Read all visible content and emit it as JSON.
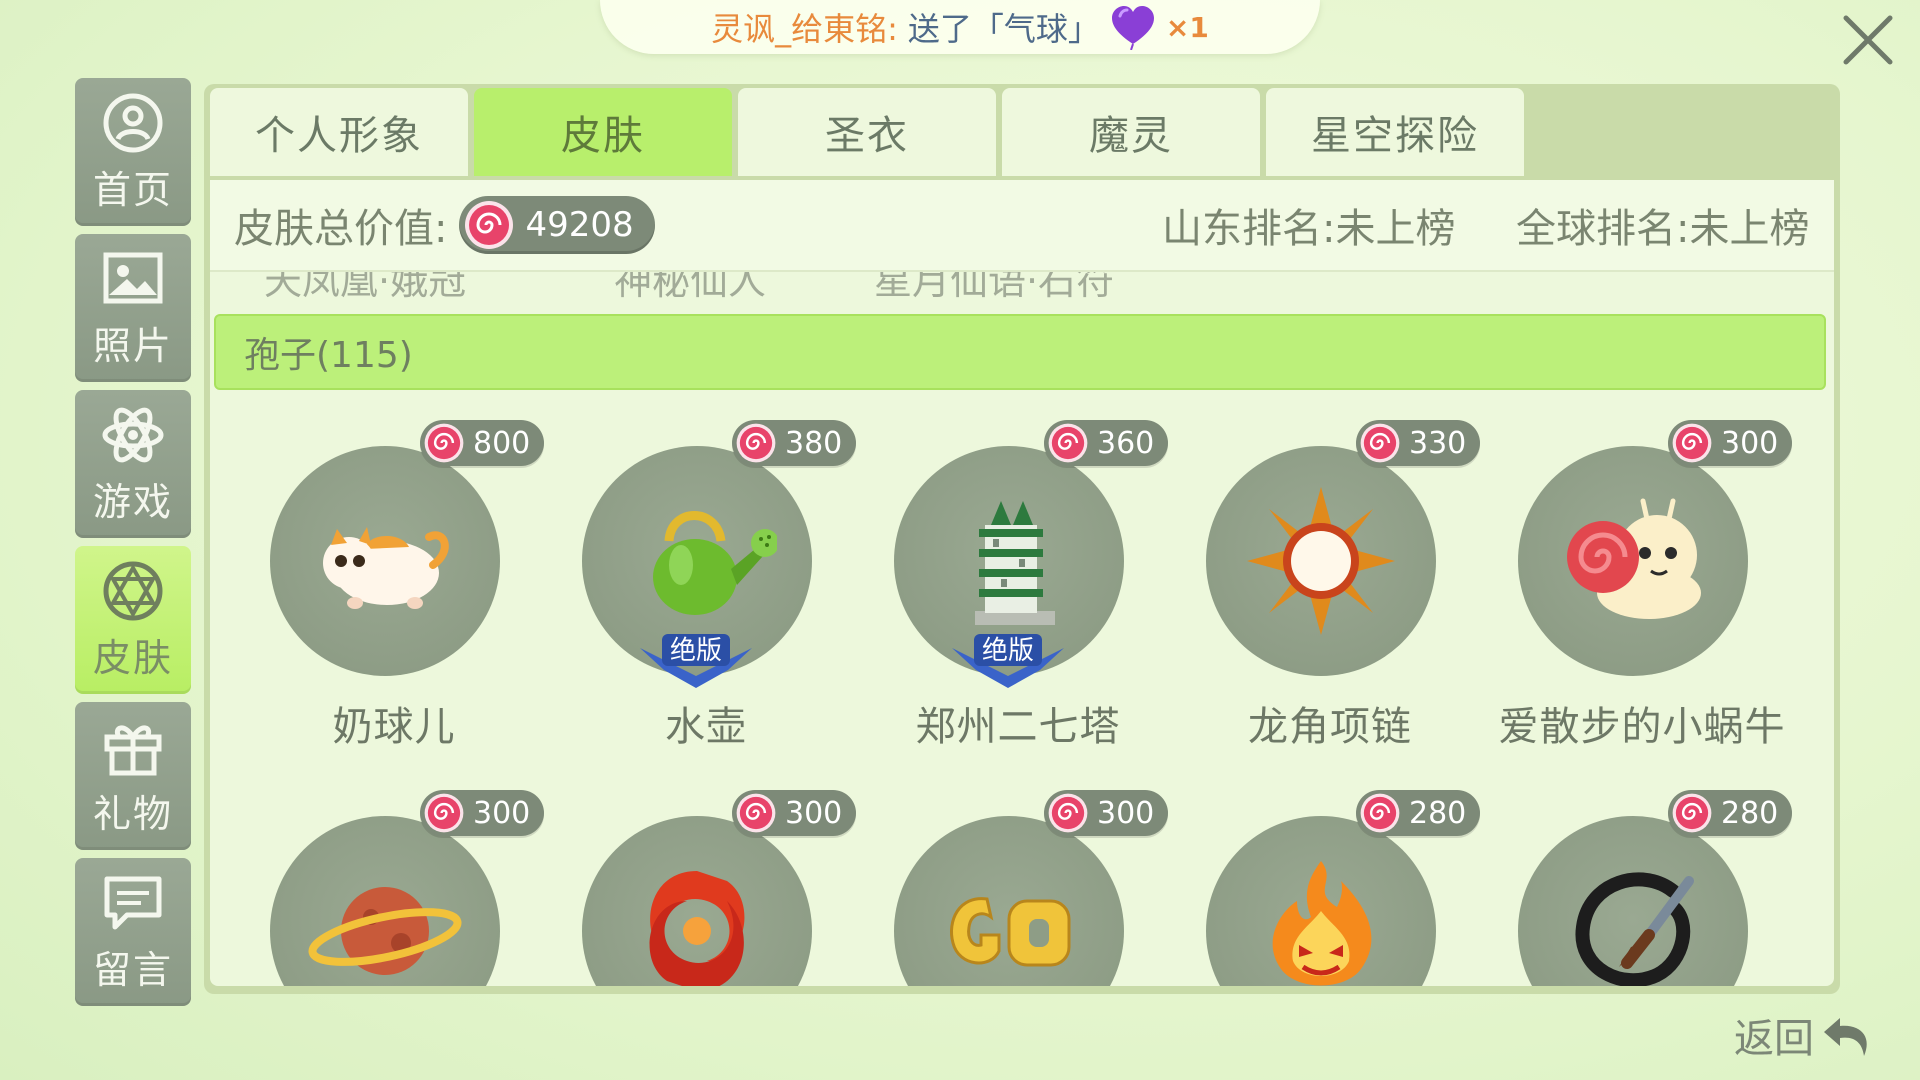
{
  "banner": {
    "sender": "灵讽_给東铭:",
    "action": "送了「气球」",
    "times": "×1"
  },
  "sidebar": {
    "items": [
      {
        "label": "首页",
        "icon": "home-icon",
        "active": false
      },
      {
        "label": "照片",
        "icon": "photo-icon",
        "active": false
      },
      {
        "label": "游戏",
        "icon": "game-icon",
        "active": false
      },
      {
        "label": "皮肤",
        "icon": "skin-icon",
        "active": true
      },
      {
        "label": "礼物",
        "icon": "gift-icon",
        "active": false
      },
      {
        "label": "留言",
        "icon": "message-icon",
        "active": false
      }
    ]
  },
  "tabs": [
    {
      "label": "个人形象",
      "active": false
    },
    {
      "label": "皮肤",
      "active": true
    },
    {
      "label": "圣衣",
      "active": false
    },
    {
      "label": "魔灵",
      "active": false
    },
    {
      "label": "星空探险",
      "active": false
    }
  ],
  "summary": {
    "label": "皮肤总价值:",
    "total": "49208",
    "rank_shandong": "山东排名:未上榜",
    "rank_global": "全球排名:未上榜"
  },
  "cut_row": [
    "天凤凰·娥冠",
    "神秘仙人",
    "星月仙语·石符"
  ],
  "group": {
    "label": "孢子(115)"
  },
  "items": [
    {
      "name": "奶球儿",
      "price": "800",
      "icon": "cat-icon",
      "discontinued": false
    },
    {
      "name": "水壶",
      "price": "380",
      "icon": "watering-can-icon",
      "discontinued": true
    },
    {
      "name": "郑州二七塔",
      "price": "360",
      "icon": "pagoda-icon",
      "discontinued": true
    },
    {
      "name": "龙角项链",
      "price": "330",
      "icon": "sun-necklace-icon",
      "discontinued": false
    },
    {
      "name": "爱散步的小蜗牛",
      "price": "300",
      "icon": "snail-icon",
      "discontinued": false
    },
    {
      "name": "",
      "price": "300",
      "icon": "planet-icon",
      "discontinued": false
    },
    {
      "name": "",
      "price": "300",
      "icon": "red-swirl-icon",
      "discontinued": false
    },
    {
      "name": "",
      "price": "300",
      "icon": "go-icon",
      "discontinued": false
    },
    {
      "name": "",
      "price": "280",
      "icon": "fire-face-icon",
      "discontinued": false
    },
    {
      "name": "",
      "price": "280",
      "icon": "ink-brush-icon",
      "discontinued": false
    }
  ],
  "discontinued_label": "绝版",
  "back": {
    "label": "返回"
  },
  "colors": {
    "accent": "#b8ef6c",
    "sidebar_bg": "#8a9985",
    "badge_bg": "#7d8a78",
    "coin": "#e8436a"
  }
}
